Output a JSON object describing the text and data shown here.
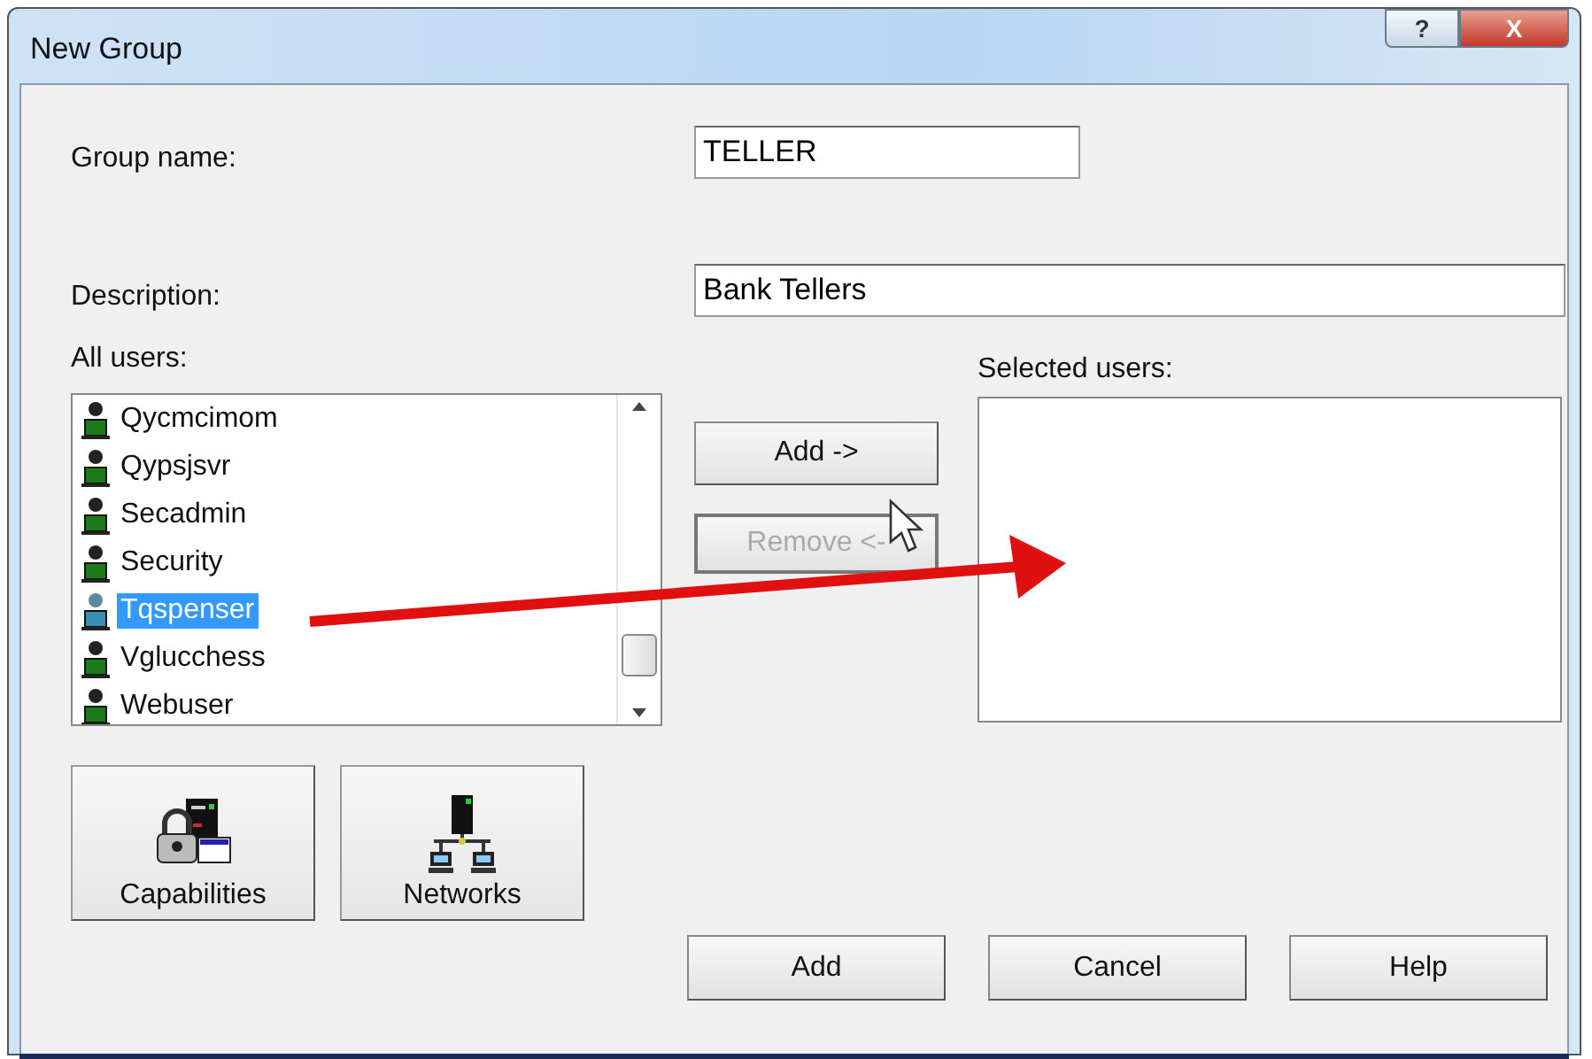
{
  "window": {
    "title": "New Group",
    "title_buttons": [
      {
        "kind": "help",
        "label": "?"
      },
      {
        "kind": "close",
        "label": "X"
      }
    ]
  },
  "group_name": {
    "label": "Group name:",
    "value": "TELLER"
  },
  "description": {
    "label": "Description:",
    "value": "Bank Tellers"
  },
  "all_users": {
    "label": "All users:",
    "items": [
      {
        "name": "Qycmcimom",
        "selected": false
      },
      {
        "name": "Qypsjsvr",
        "selected": false
      },
      {
        "name": "Secadmin",
        "selected": false
      },
      {
        "name": "Security",
        "selected": false
      },
      {
        "name": "Tqspenser",
        "selected": true
      },
      {
        "name": "Vglucchess",
        "selected": false
      },
      {
        "name": "Webuser",
        "selected": false
      }
    ]
  },
  "selected_users": {
    "label": "Selected users:"
  },
  "move_buttons": [
    {
      "label": "Add ->",
      "disabled": false
    },
    {
      "label": "Remove <-",
      "disabled": true
    }
  ],
  "tool_buttons": [
    {
      "kind": "capabilities",
      "label": "Capabilities"
    },
    {
      "kind": "networks",
      "label": "Networks"
    }
  ],
  "footer_buttons": [
    "Add",
    "Cancel",
    "Help"
  ]
}
